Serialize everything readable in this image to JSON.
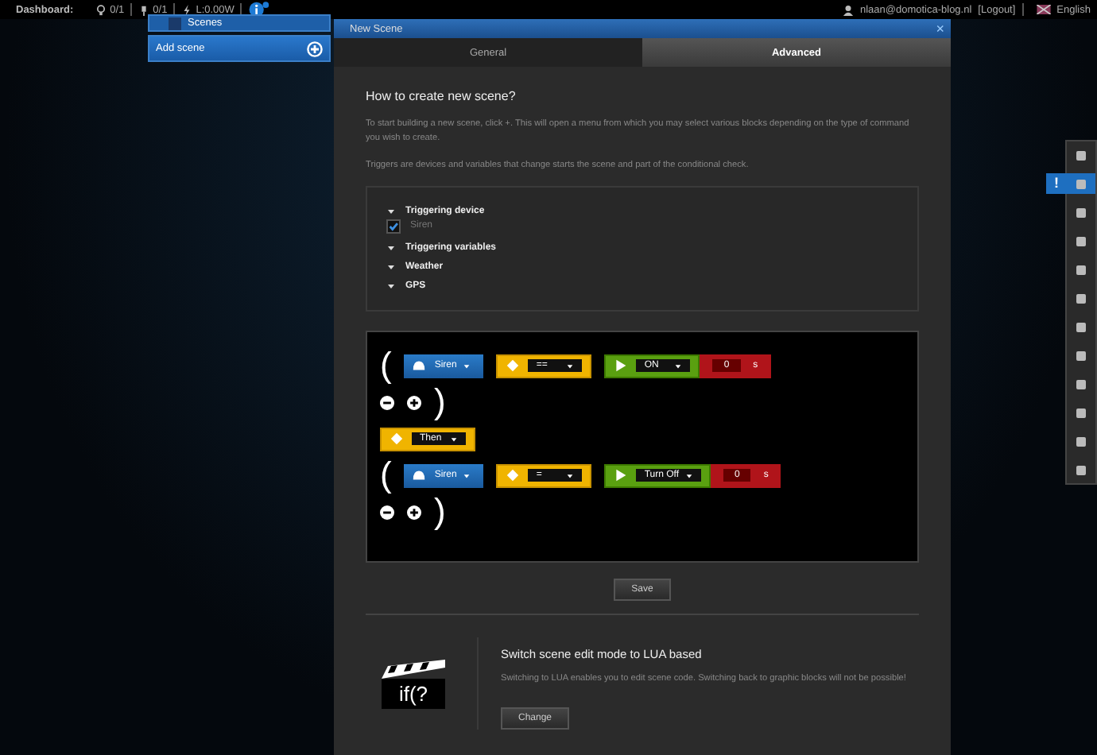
{
  "topbar": {
    "label": "Dashboard:",
    "stats": [
      {
        "kind": "bulb",
        "text": "0/1"
      },
      {
        "kind": "plug",
        "text": "0/1"
      },
      {
        "kind": "power",
        "text": "L:0.00W"
      }
    ],
    "user": "nlaan@domotica-blog.nl",
    "logout": "[Logout]",
    "language": "English"
  },
  "sidebar": {
    "items": [
      {
        "kind": "header",
        "label": "Scenes"
      },
      {
        "kind": "action",
        "label": "Add scene"
      }
    ]
  },
  "dialog": {
    "title": "New Scene",
    "close": "×",
    "tabs": [
      {
        "label": "General",
        "selected": false
      },
      {
        "label": "Advanced",
        "selected": true
      }
    ],
    "heading": "How to create new scene?",
    "paragraphs": [
      "To start building a new scene, click +. This will open a menu from which you may select various blocks depending on the type of command you wish to create.",
      "Triggers are devices and variables that change starts the scene and part of the conditional check."
    ],
    "triggers": [
      {
        "label": "Triggering device",
        "children": [
          {
            "label": "Siren",
            "checked": true
          }
        ]
      },
      {
        "label": "Triggering variables"
      },
      {
        "label": "Weather"
      },
      {
        "label": "GPS"
      }
    ],
    "blocks": [
      {
        "kind": "condition",
        "open": "(",
        "close": ")",
        "items": [
          {
            "kind": "device",
            "value": "Siren"
          },
          {
            "kind": "operator",
            "value": "=="
          },
          {
            "kind": "action",
            "value": "ON"
          },
          {
            "kind": "delay",
            "value": "0",
            "unit": "s"
          }
        ]
      },
      {
        "kind": "then",
        "value": "Then"
      },
      {
        "kind": "condition",
        "open": "(",
        "close": ")",
        "items": [
          {
            "kind": "device",
            "value": "Siren"
          },
          {
            "kind": "operator",
            "value": "="
          },
          {
            "kind": "action",
            "value": "Turn Off"
          },
          {
            "kind": "delay",
            "value": "0",
            "unit": "s"
          }
        ]
      }
    ],
    "save": "Save",
    "lua": {
      "icon_text": "if(?",
      "heading": "Switch scene edit mode to LUA based",
      "text": "Switching to LUA enables you to edit scene code. Switching back to graphic blocks will not be possible!",
      "button": "Change"
    }
  },
  "toolbar": {
    "alert": "!"
  }
}
